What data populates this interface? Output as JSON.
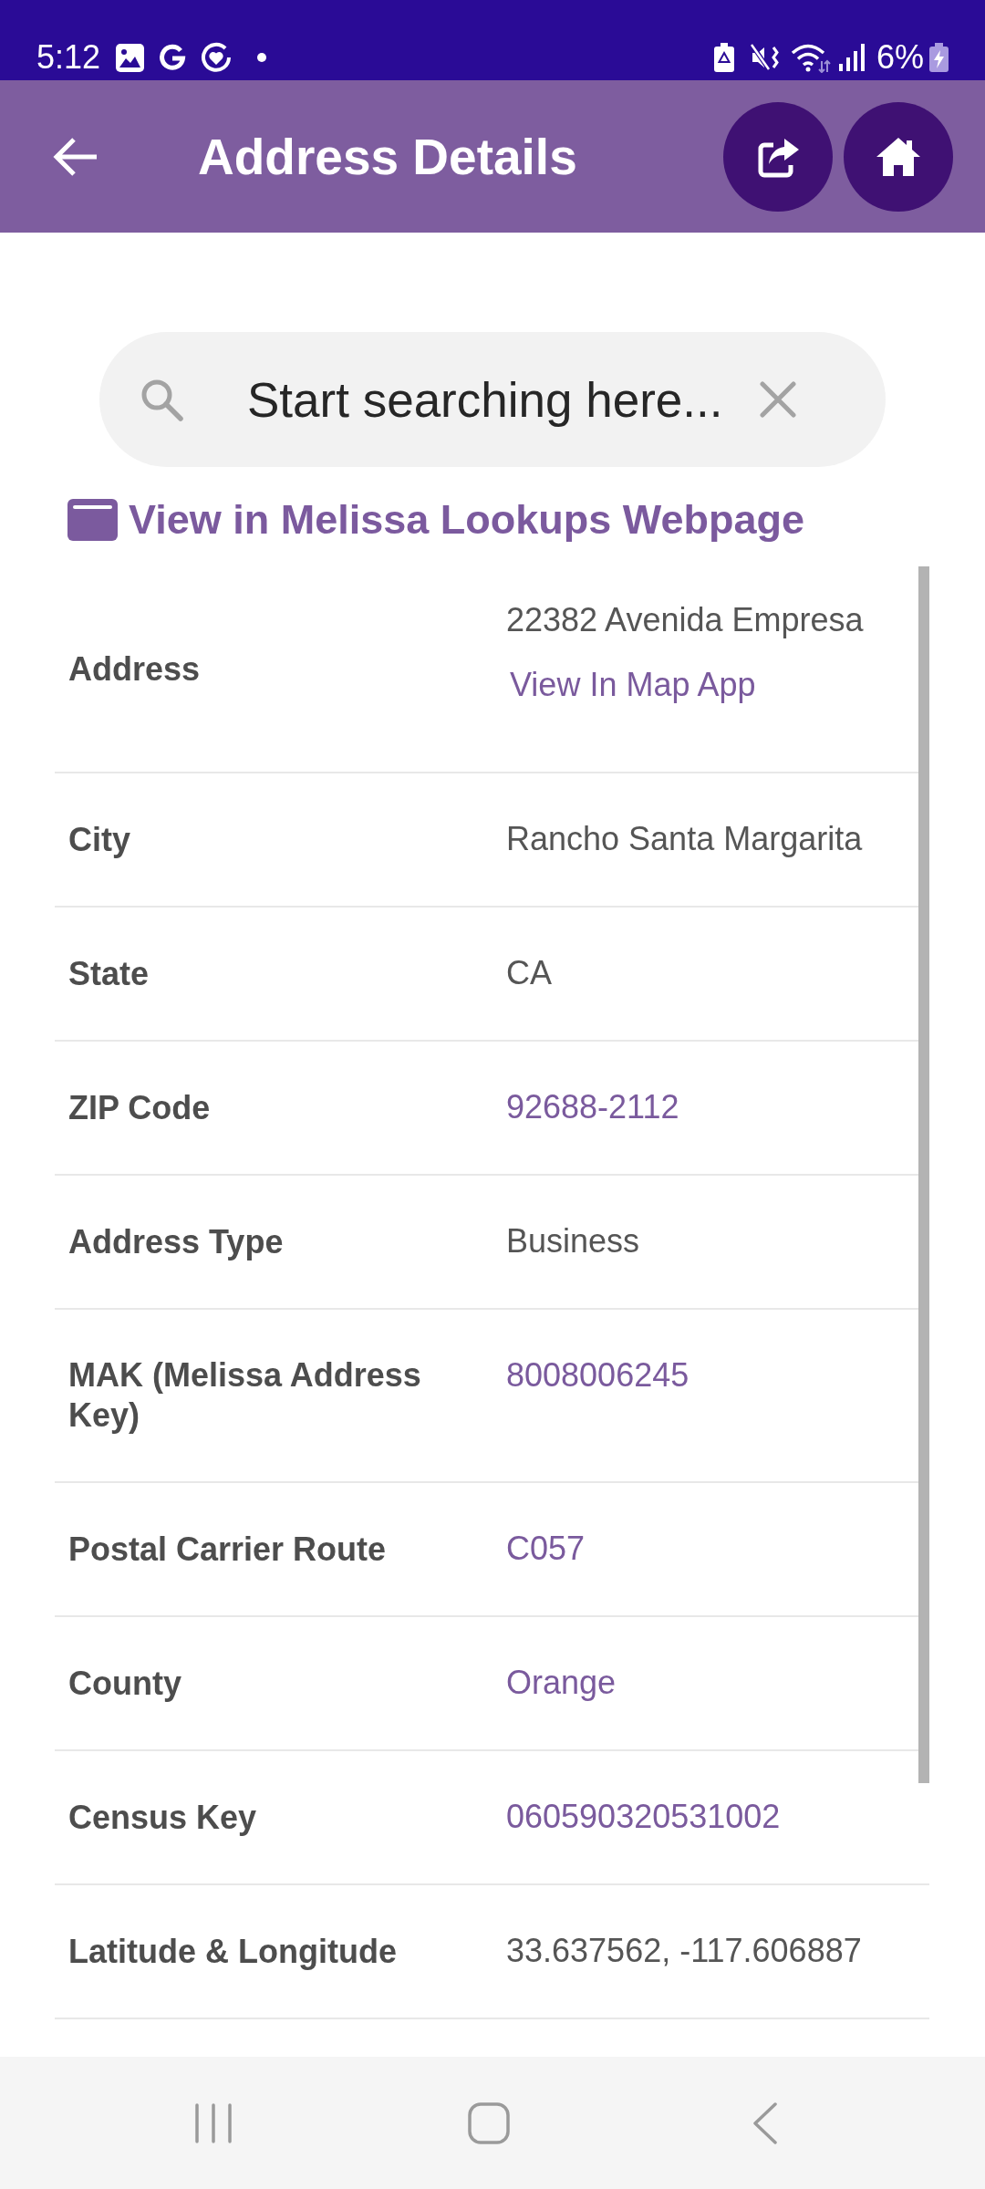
{
  "status_bar": {
    "time": "5:12",
    "battery": "6%"
  },
  "app_bar": {
    "title": "Address Details"
  },
  "search": {
    "placeholder": "Start searching here..."
  },
  "web_link": {
    "label": "View in Melissa Lookups Webpage"
  },
  "details": [
    {
      "label": "Address",
      "values": [
        {
          "kind": "text",
          "text": "22382 Avenida Empresa"
        },
        {
          "kind": "link",
          "text": "View In Map App"
        }
      ]
    },
    {
      "label": "City",
      "values": [
        {
          "kind": "text",
          "text": "Rancho Santa Margarita"
        }
      ]
    },
    {
      "label": "State",
      "values": [
        {
          "kind": "text",
          "text": "CA"
        }
      ]
    },
    {
      "label": "ZIP Code",
      "values": [
        {
          "kind": "link",
          "text": "92688-2112"
        }
      ]
    },
    {
      "label": "Address Type",
      "values": [
        {
          "kind": "text",
          "text": "Business"
        }
      ]
    },
    {
      "label": "MAK (Melissa Address Key)",
      "values": [
        {
          "kind": "link",
          "text": "8008006245"
        }
      ]
    },
    {
      "label": "Postal Carrier Route",
      "values": [
        {
          "kind": "link",
          "text": "C057"
        }
      ]
    },
    {
      "label": "County",
      "values": [
        {
          "kind": "link",
          "text": "Orange"
        }
      ]
    },
    {
      "label": "Census Key",
      "values": [
        {
          "kind": "link",
          "text": "060590320531002"
        }
      ]
    },
    {
      "label": "Latitude & Longitude",
      "values": [
        {
          "kind": "text",
          "text": "33.637562, -117.606887"
        }
      ]
    }
  ]
}
